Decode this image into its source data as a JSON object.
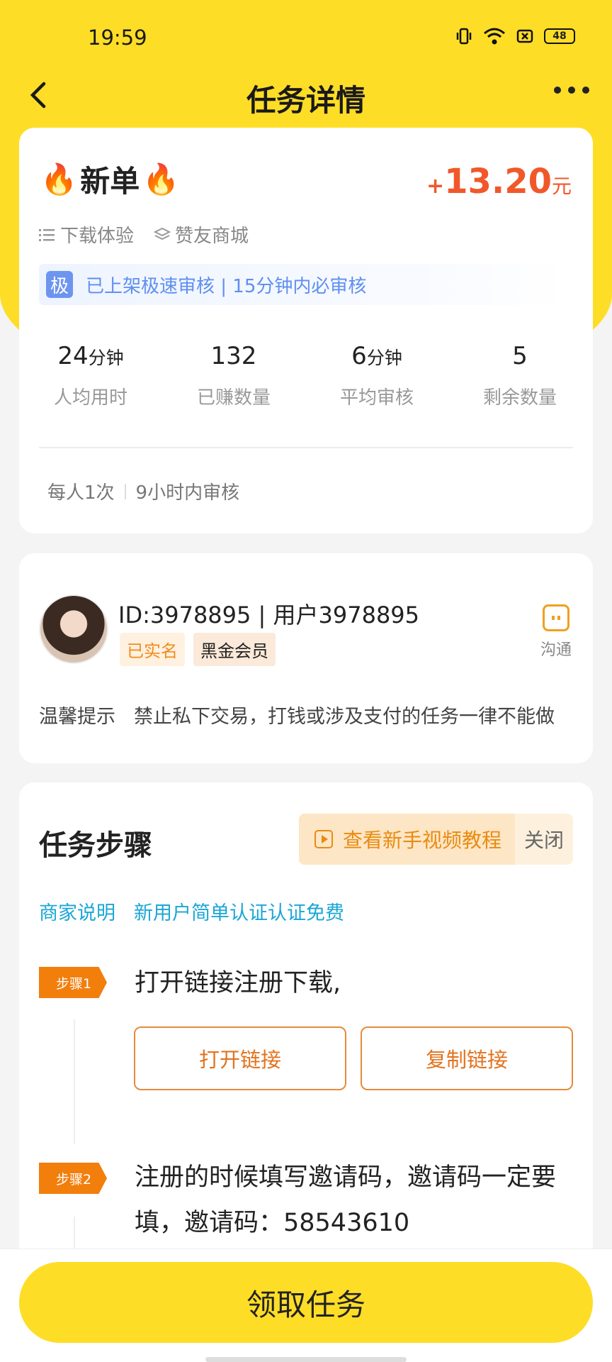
{
  "status": {
    "time": "19:59",
    "battery": "48"
  },
  "nav": {
    "title": "任务详情"
  },
  "task": {
    "title": "新单",
    "reward_plus": "+",
    "reward_amount": "13.20",
    "reward_unit": "元",
    "tags": [
      "下载体验",
      "赞友商城"
    ],
    "banner_badge": "极",
    "banner_text": "已上架极速审核 | 15分钟内必审核",
    "stats": [
      {
        "value": "24",
        "unit": "分钟",
        "label": "人均用时"
      },
      {
        "value": "132",
        "unit": "",
        "label": "已赚数量"
      },
      {
        "value": "6",
        "unit": "分钟",
        "label": "平均审核"
      },
      {
        "value": "5",
        "unit": "",
        "label": "剩余数量"
      }
    ],
    "limit": "每人1次",
    "review": "9小时内审核"
  },
  "publisher": {
    "name": "ID:3978895 | 用户3978895",
    "badge_verified": "已实名",
    "badge_vip": "黑金会员",
    "chat_label": "沟通",
    "tip_label": "温馨提示",
    "tip_text": "禁止私下交易，打钱或涉及支付的任务一律不能做"
  },
  "steps": {
    "title": "任务步骤",
    "video_label": "查看新手视频教程",
    "close_label": "关闭",
    "merchant_label": "商家说明",
    "merchant_text": "新用户简单认证认证免费",
    "step1_tag": "步骤1",
    "step1_text": "打开链接注册下载,",
    "open_link": "打开链接",
    "copy_link": "复制链接",
    "step2_tag": "步骤2",
    "step2_text": "注册的时候填写邀请码，邀请码一定要填，邀请码：58543610"
  },
  "bottom": {
    "claim_label": "领取任务"
  },
  "colors": {
    "accent_yellow": "#fedd27",
    "reward_red": "#f0582a",
    "step_orange": "#f27e0c",
    "link_blue": "#1ba6d6"
  }
}
